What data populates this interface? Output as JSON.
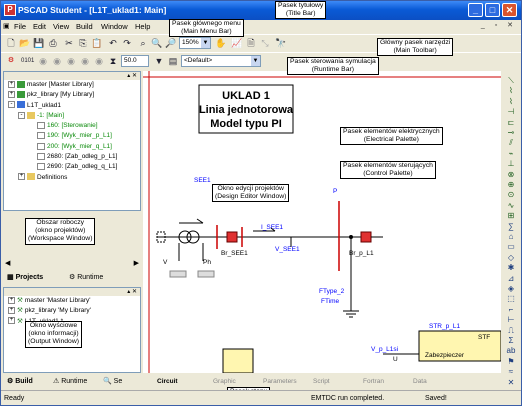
{
  "window": {
    "title": "PSCAD Student - [L1T_uklad1: Main]"
  },
  "menu": {
    "items": [
      "File",
      "Edit",
      "View",
      "Build",
      "Window",
      "Help"
    ]
  },
  "toolbar": {
    "zoom": "150%"
  },
  "runtime": {
    "value1": "50.0",
    "default_combo": "<Default>"
  },
  "workspace": {
    "tree": [
      {
        "label": "master [Master Library]",
        "level": 0,
        "exp": "+",
        "color": "#000"
      },
      {
        "label": "pkz_library [My Library]",
        "level": 0,
        "exp": "+",
        "color": "#000"
      },
      {
        "label": "L1T_uklad1",
        "level": 0,
        "exp": "-",
        "color": "#000"
      },
      {
        "label": "-1: [Main]",
        "level": 1,
        "exp": "-",
        "color": "#0a8a0a"
      },
      {
        "label": "160: [Sterowanie]",
        "level": 2,
        "exp": "",
        "color": "#0a8a0a"
      },
      {
        "label": "190: [Wyk_mier_p_L1]",
        "level": 2,
        "exp": "",
        "color": "#0a8a0a"
      },
      {
        "label": "200: [Wyk_mier_q_L1]",
        "level": 2,
        "exp": "",
        "color": "#0a8a0a"
      },
      {
        "label": "2680: [Zab_odleg_p_L1]",
        "level": 2,
        "exp": "",
        "color": "#000"
      },
      {
        "label": "2690: [Zab_odleg_q_L1]",
        "level": 2,
        "exp": "",
        "color": "#000"
      },
      {
        "label": "Definitions",
        "level": 1,
        "exp": "+",
        "color": "#000"
      }
    ],
    "tabs": [
      "Projects",
      "Runtime"
    ]
  },
  "output": {
    "tree": [
      {
        "label": "master 'Master Library'",
        "exp": "+"
      },
      {
        "label": "pkz_library 'My Library'",
        "exp": "+"
      },
      {
        "label": "L1T_uklad1 *",
        "exp": "+"
      }
    ],
    "tabs": [
      "Build",
      "Runtime",
      "Se"
    ]
  },
  "callouts": {
    "title_bar": "Pasek tytułowy\n(Title Bar)",
    "main_menu": "Pasek głównego menu\n(Main Menu Bar)",
    "main_toolbar": "Główny pasek narzędzi\n(Main Toolbar)",
    "runtime_bar": "Pasek sterowania symulacja\n(Runtime Bar)",
    "electrical_palette": "Pasek elementów elektrycznych\n(Electrical Palette)",
    "control_palette": "Pasek elementów sterujących\n(Control Palette)",
    "design_editor": "Okno edycji projektów\n(Design Editor Window)",
    "workspace": "Obszar roboczy\n(okno projektów)\n(Workspace Window)",
    "output_window": "Okno wyściowe\n(okno informacji)\n(Output Window)",
    "status_bar": "Pasek stanu\n(Staus Bar)"
  },
  "diagram": {
    "title": "UKLAD 1\nLinia jednotorowa\nModel typu PI",
    "labels": {
      "see1": "SEE1",
      "i_see1": "I_SEE1",
      "v_see1": "V_SEE1",
      "br_see1": "Br_SEE1",
      "br_p_l1": "Br_p_L1",
      "p": "P",
      "v": "V",
      "ph": "Ph",
      "ftype2": "FType_2",
      "ftime": "FTime",
      "str_p_l1": "STR_p_L1",
      "str": "STF",
      "v_p_l1si": "V_p_L1si",
      "u": "U",
      "zabezpieczen": "Zabezpieczer"
    }
  },
  "editor_tabs": [
    "Circuit",
    "Graphic",
    "Parameters",
    "Script",
    "Fortran",
    "Data"
  ],
  "status": {
    "ready": "Ready",
    "message": "EMTDC run completed.",
    "saved": "Saved!"
  }
}
